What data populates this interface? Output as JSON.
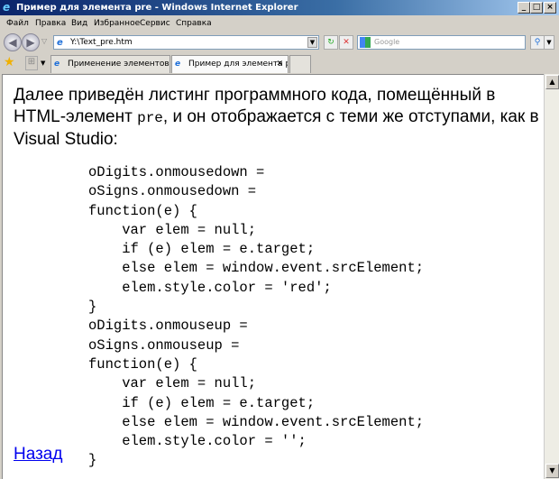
{
  "window": {
    "title": "Пример для элемента pre - Windows Internet Explorer",
    "min": "_",
    "max": "□",
    "close": "×"
  },
  "menu": [
    "Файл",
    "Правка",
    "Вид",
    "Избранное",
    "Сервис",
    "Справка"
  ],
  "address": {
    "url": "Y:\\Text_pre.htm",
    "search_placeholder": "Google"
  },
  "tabs": [
    {
      "label": "Применение элементов HT..."
    },
    {
      "label": "Пример для элемента pre",
      "close": "✕"
    }
  ],
  "content": {
    "intro_before": "Далее приведён листинг программного кода, помещённый в HTML-элемент ",
    "intro_code": "pre",
    "intro_after": ", и он отображается с теми же отступами, как в Visual Studio:",
    "code": "oDigits.onmousedown =\noSigns.onmousedown =\nfunction(e) {\n    var elem = null;\n    if (e) elem = e.target;\n    else elem = window.event.srcElement;\n    elem.style.color = 'red';\n}\noDigits.onmouseup =\noSigns.onmouseup =\nfunction(e) {\n    var elem = null;\n    if (e) elem = e.target;\n    else elem = window.event.srcElement;\n    elem.style.color = '';\n}",
    "back_link": "Назад"
  }
}
